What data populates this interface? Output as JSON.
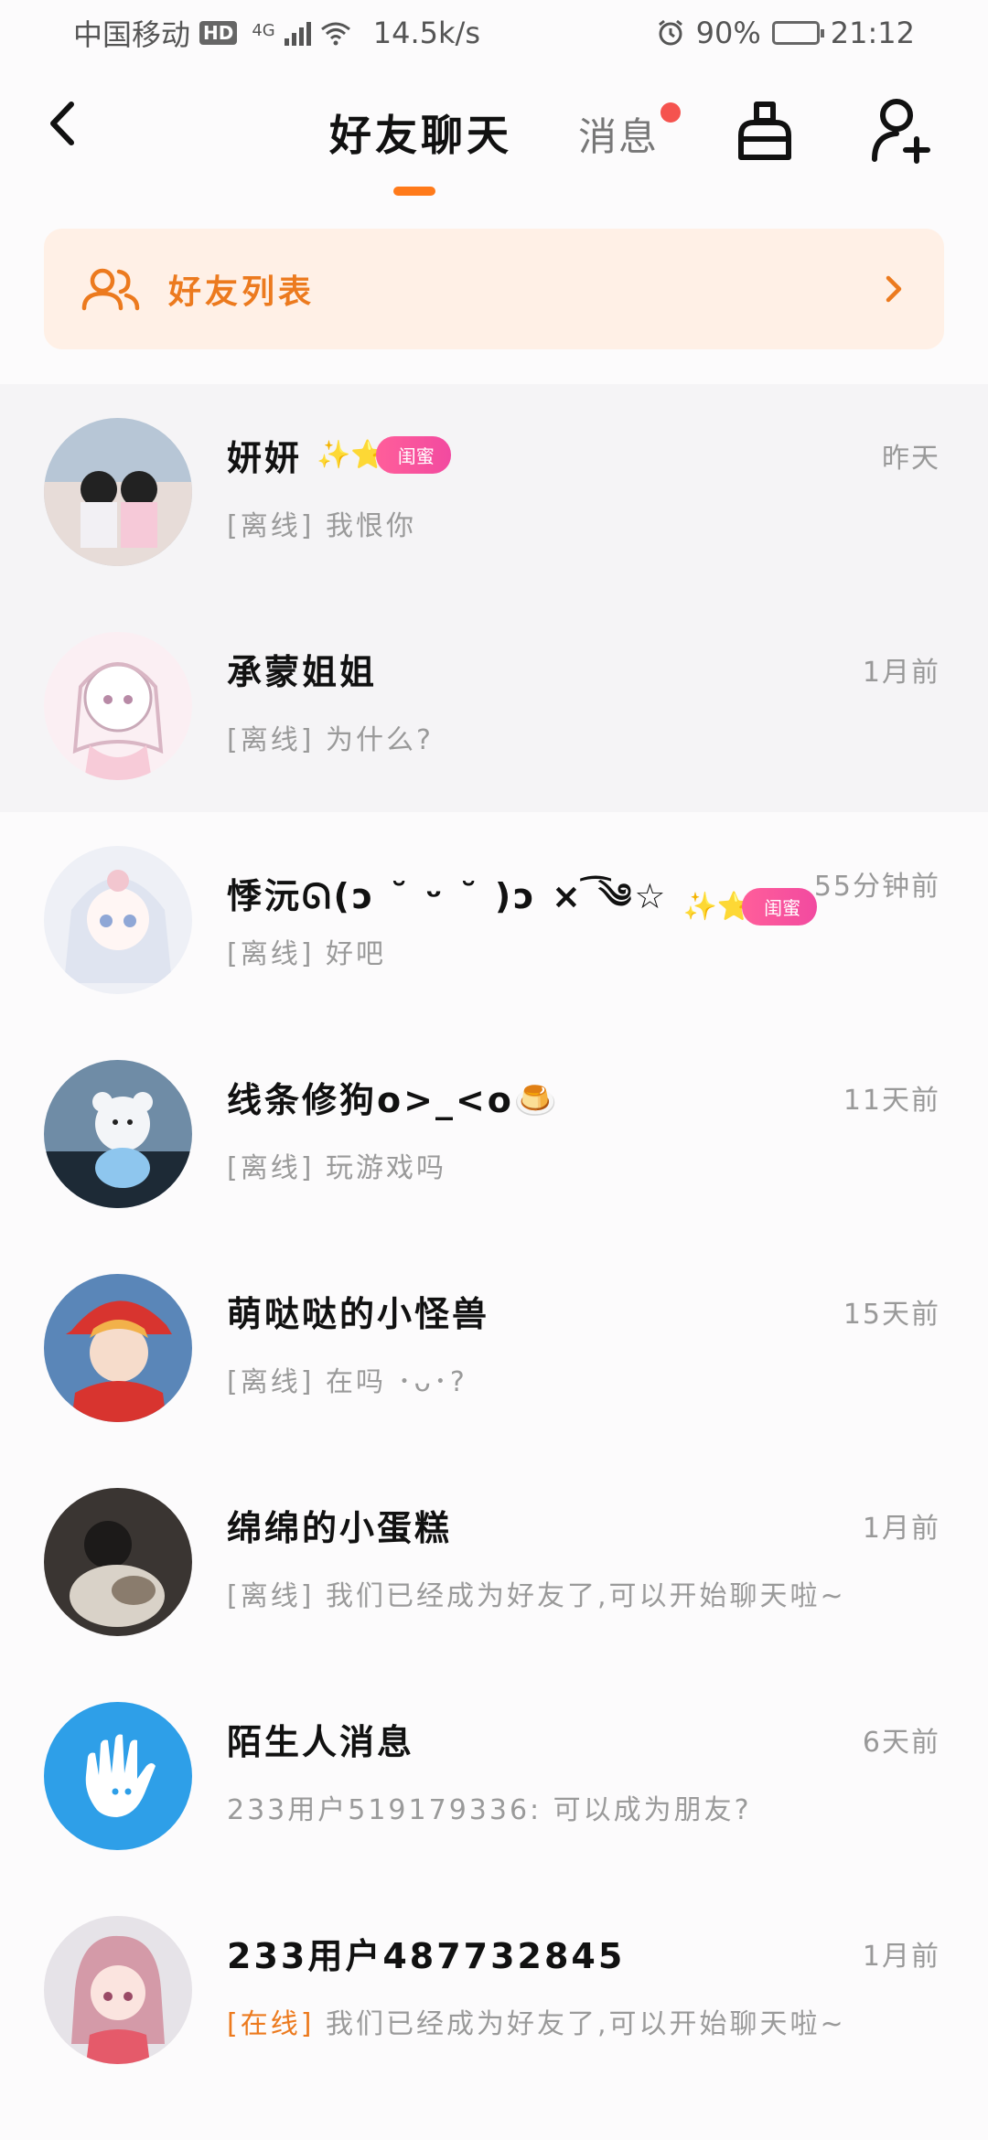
{
  "status_bar": {
    "carrier": "中国移动",
    "hd": "HD",
    "network": "4G",
    "speed": "14.5k/s",
    "battery": "90%",
    "battery_level": 0.9,
    "time": "21:12"
  },
  "header": {
    "tab_friends": "好友聊天",
    "tab_messages": "消息"
  },
  "banner": {
    "label": "好友列表"
  },
  "chats": [
    {
      "name": "妍妍",
      "badge_stars": "✨⭐",
      "badge": "闺蜜",
      "time": "昨天",
      "status": "[离线]",
      "preview": "我恨你",
      "online": false,
      "highlight": true
    },
    {
      "name": "承蒙姐姐",
      "time": "1月前",
      "status": "[离线]",
      "preview": "为什么?",
      "online": false,
      "highlight": true
    },
    {
      "name": "悸沅ᘏ(ɔ ˘ ᵕ ˘ )ɔ × ͡༄☆",
      "badge_stars": "✨⭐",
      "badge": "闺蜜",
      "time": "55分钟前",
      "status": "[离线]",
      "preview": "好吧",
      "online": false
    },
    {
      "name": "线条修狗o>_<o🍮",
      "time": "11天前",
      "status": "[离线]",
      "preview": "玩游戏吗",
      "online": false
    },
    {
      "name": "萌哒哒的小怪兽",
      "time": "15天前",
      "status": "[离线]",
      "preview": "在吗 ･ᴗ･?",
      "online": false
    },
    {
      "name": "绵绵的小蛋糕",
      "time": "1月前",
      "status": "[离线]",
      "preview": "我们已经成为好友了,可以开始聊天啦~",
      "online": false
    },
    {
      "name": "陌生人消息",
      "time": "6天前",
      "status": "",
      "preview": "233用户519179336: 可以成为朋友?",
      "online": false
    },
    {
      "name": "233用户487732845",
      "time": "1月前",
      "status": "[在线]",
      "preview": "我们已经成为好友了,可以开始聊天啦~",
      "online": true
    }
  ],
  "colors": {
    "accent": "#ec7a1e",
    "tab_indicator": "#ff7a1a",
    "unread_dot": "#f5534f",
    "badge_pink": "#f24aa0",
    "banner_bg": "#fff0e6"
  }
}
